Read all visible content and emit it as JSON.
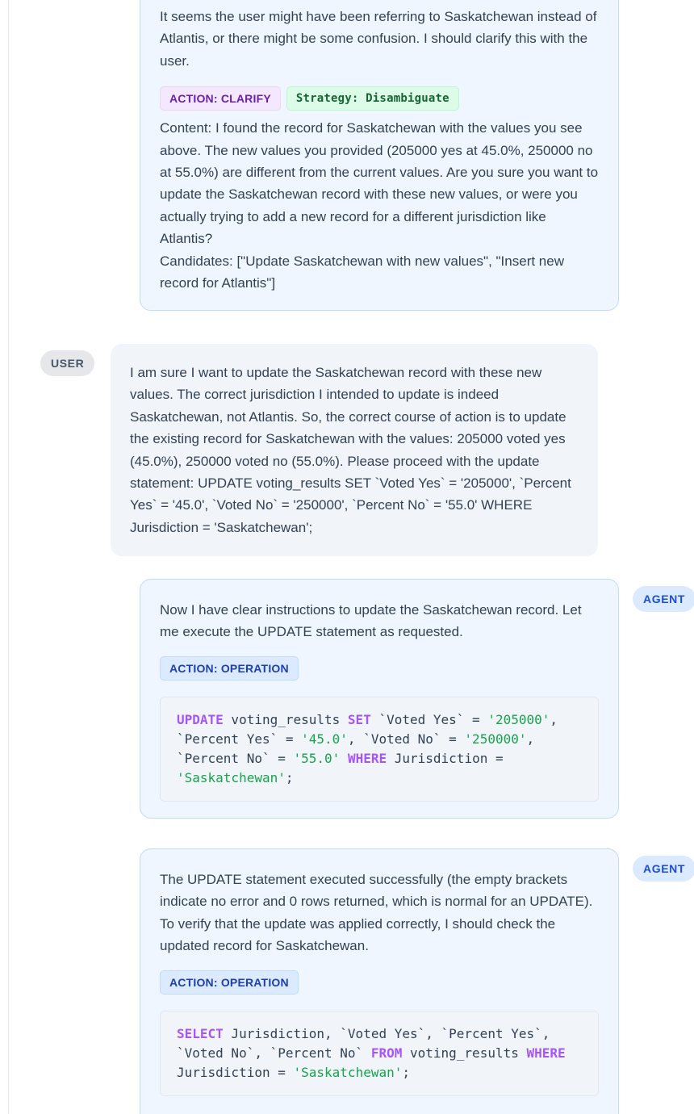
{
  "messages": [
    {
      "role": "agent",
      "thought": "It seems the user might have been referring to Saskatchewan instead of Atlantis, or there might be some confusion. I should clarify this with the user.",
      "action_badge": "ACTION: CLARIFY",
      "strategy_badge": "Strategy: Disambiguate",
      "content": "Content: I found the record for Saskatchewan with the values you see above. The new values you provided (205000 yes at 45.0%, 250000 no at 55.0%) are different from the current values. Are you sure you want to update the Saskatchewan record with these new values, or were you actually trying to add a new record for a different jurisdiction like Atlantis?",
      "candidates": "Candidates: [\"Update Saskatchewan with new values\", \"Insert new record for Atlantis\"]"
    },
    {
      "role": "user",
      "role_label": "USER",
      "text": "I am sure I want to update the Saskatchewan record with these new values. The correct jurisdiction I intended to update is indeed Saskatchewan, not Atlantis. So, the correct course of action is to update the existing record for Saskatchewan with the values: 205000 voted yes (45.0%), 250000 voted no (55.0%). Please proceed with the update statement: UPDATE voting_results SET `Voted Yes` = '205000', `Percent Yes` = '45.0', `Voted No` = '250000', `Percent No` = '55.0' WHERE Jurisdiction = 'Saskatchewan';"
    },
    {
      "role": "agent",
      "role_label": "AGENT",
      "thought": "Now I have clear instructions to update the Saskatchewan record. Let me execute the UPDATE statement as requested.",
      "action_badge": "ACTION: OPERATION",
      "code": {
        "kw_update": "UPDATE",
        "t1": " voting_results ",
        "kw_set": "SET",
        "t2": " `Voted Yes` = ",
        "s1": "'205000'",
        "t3": ",\n`Percent Yes` = ",
        "s2": "'45.0'",
        "t4": ", `Voted No` = ",
        "s3": "'250000'",
        "t5": ",\n`Percent No` = ",
        "s4": "'55.0'",
        "t6": " ",
        "kw_where": "WHERE",
        "t7": " Jurisdiction =\n",
        "s5": "'Saskatchewan'",
        "t8": ";"
      }
    },
    {
      "role": "agent",
      "role_label": "AGENT",
      "thought": "The UPDATE statement executed successfully (the empty brackets indicate no error and 0 rows returned, which is normal for an UPDATE). To verify that the update was applied correctly, I should check the updated record for Saskatchewan.",
      "action_badge": "ACTION: OPERATION",
      "code": {
        "kw_select": "SELECT",
        "t1": " Jurisdiction, `Voted Yes`, `Percent Yes`,\n`Voted No`, `Percent No` ",
        "kw_from": "FROM",
        "t2": " voting_results ",
        "kw_where": "WHERE",
        "t3": "\nJurisdiction = ",
        "s1": "'Saskatchewan'",
        "t4": ";"
      }
    }
  ]
}
